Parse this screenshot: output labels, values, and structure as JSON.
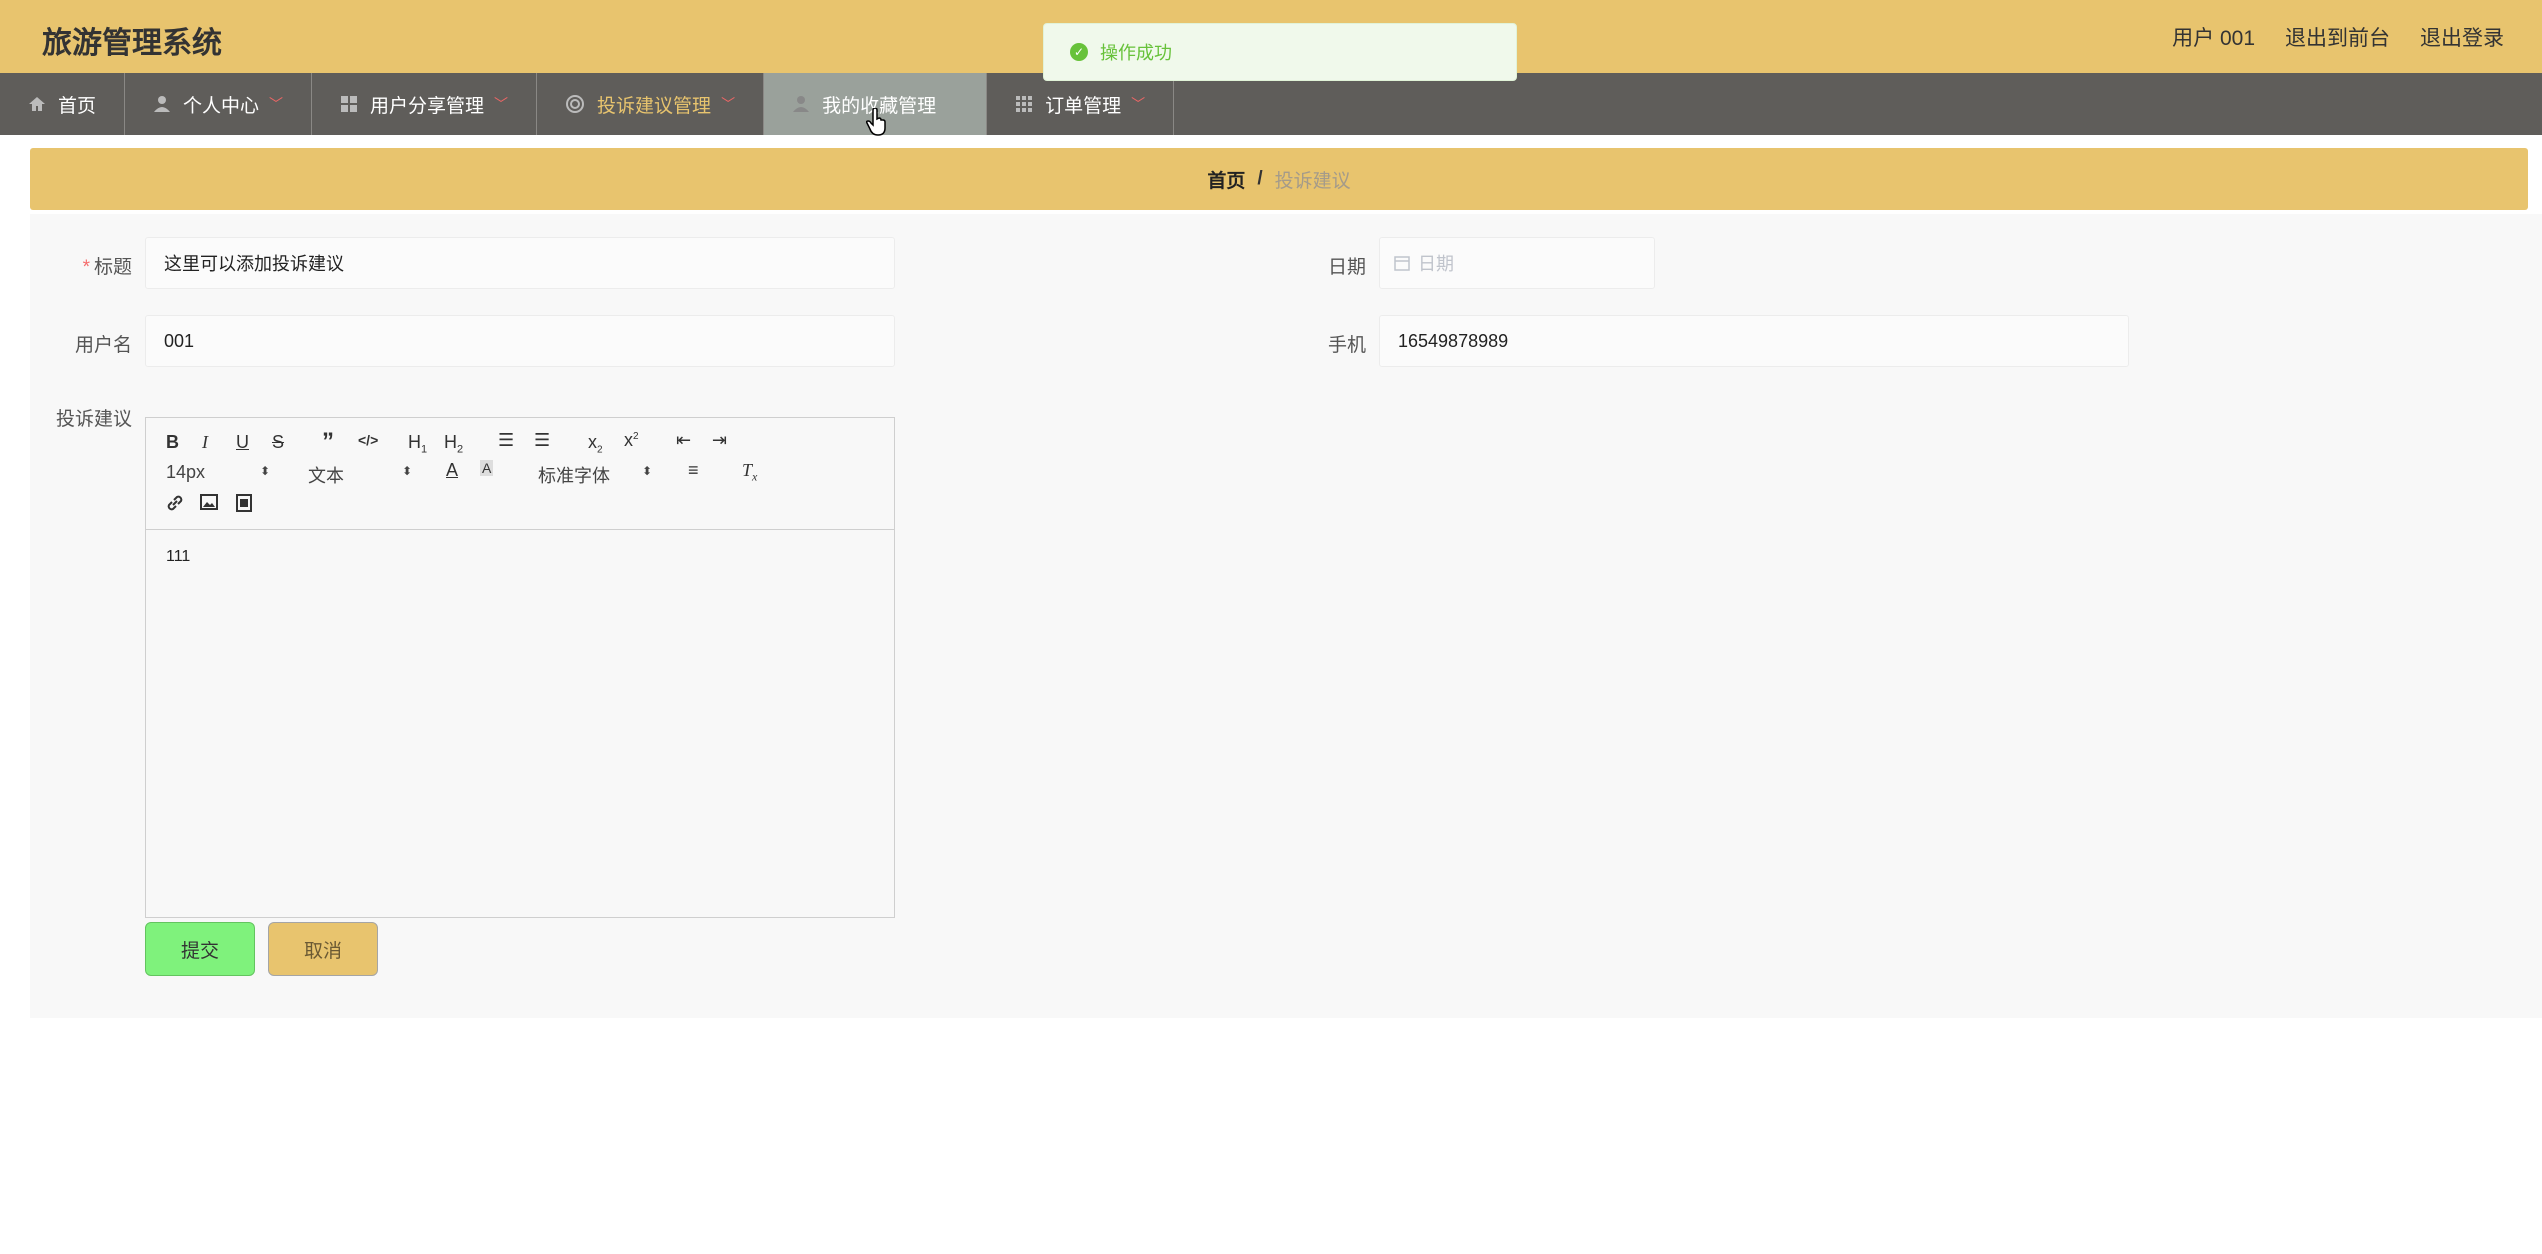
{
  "app": {
    "title": "旅游管理系统"
  },
  "header": {
    "user_label": "用户 001",
    "front_link": "退出到前台",
    "logout_link": "退出登录"
  },
  "toast": {
    "message": "操作成功"
  },
  "nav": {
    "items": [
      {
        "label": "首页",
        "icon": "home-icon"
      },
      {
        "label": "个人中心",
        "icon": "user-icon"
      },
      {
        "label": "用户分享管理",
        "icon": "grid-icon"
      },
      {
        "label": "投诉建议管理",
        "icon": "complaint-icon",
        "active": true
      },
      {
        "label": "我的收藏管理",
        "icon": "user-icon",
        "hover": true
      },
      {
        "label": "订单管理",
        "icon": "grid-icon"
      }
    ]
  },
  "breadcrumb": {
    "home": "首页",
    "separator": "/",
    "current": "投诉建议"
  },
  "form": {
    "title_label": "标题",
    "title_value": "这里可以添加投诉建议",
    "date_label": "日期",
    "date_placeholder": "日期",
    "username_label": "用户名",
    "username_value": "001",
    "phone_label": "手机",
    "phone_value": "16549878989",
    "complaint_label": "投诉建议",
    "editor": {
      "font_size": "14px",
      "header_select": "文本",
      "font_family": "标准字体",
      "content": "111"
    },
    "submit_label": "提交",
    "cancel_label": "取消"
  },
  "colors": {
    "header_bg": "#e8c46e",
    "nav_bg": "#5f5d5a",
    "success": "#67c23a",
    "submit_bg": "#7ff27c"
  }
}
